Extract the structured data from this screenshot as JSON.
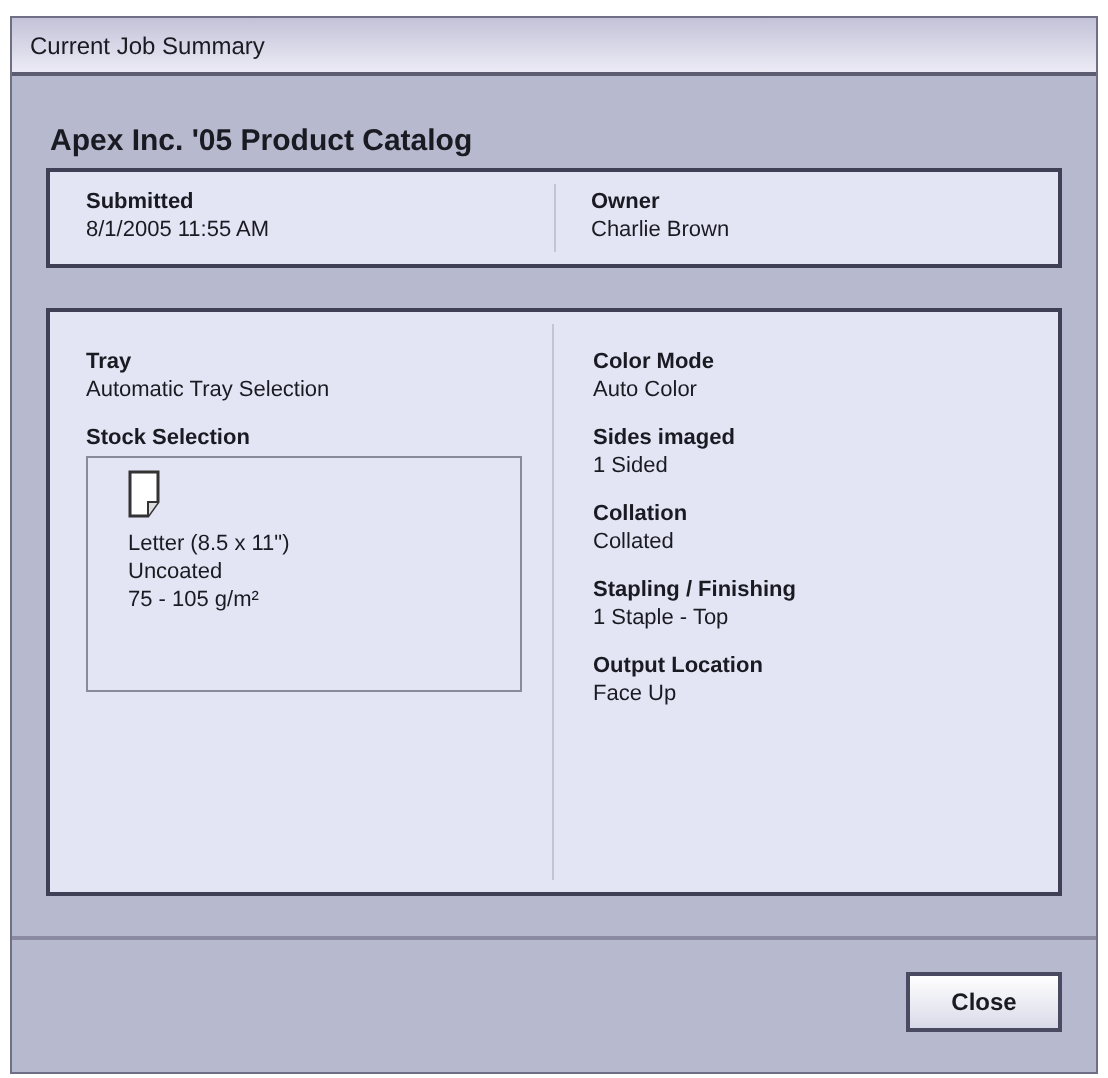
{
  "window": {
    "title": "Current Job Summary"
  },
  "job_title": "Apex Inc. '05 Product Catalog",
  "header_fields": [
    {
      "label": "Submitted",
      "value": "8/1/2005 11:55 AM"
    },
    {
      "label": "Owner",
      "value": "Charlie Brown"
    }
  ],
  "tray": {
    "label": "Tray",
    "value": "Automatic Tray Selection"
  },
  "stock_selection": {
    "label": "Stock Selection",
    "lines": [
      "Letter (8.5 x 11\")",
      "Uncoated",
      "75 - 105 g/m²"
    ]
  },
  "settings": [
    {
      "label": "Color Mode",
      "value": "Auto Color"
    },
    {
      "label": "Sides imaged",
      "value": "1 Sided"
    },
    {
      "label": "Collation",
      "value": "Collated"
    },
    {
      "label": "Stapling / Finishing",
      "value": "1 Staple - Top"
    },
    {
      "label": "Output Location",
      "value": "Face Up"
    }
  ],
  "buttons": [
    "Close"
  ]
}
